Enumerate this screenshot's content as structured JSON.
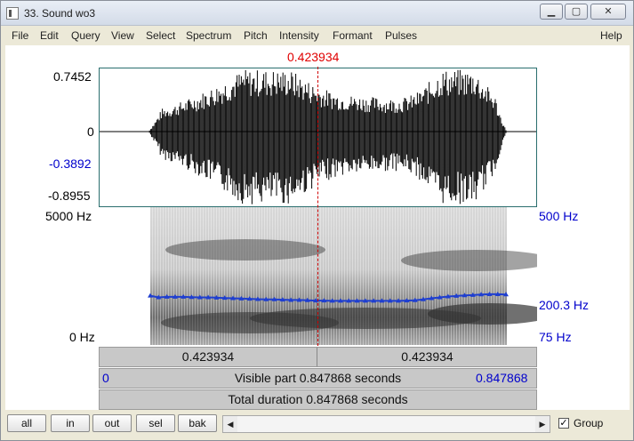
{
  "window": {
    "title": "33. Sound wo3",
    "controls": [
      "minimize-icon",
      "maximize-icon",
      "close-icon"
    ]
  },
  "menu": {
    "items": [
      "File",
      "Edit",
      "Query",
      "View",
      "Select",
      "Spectrum",
      "Pitch",
      "Intensity",
      "Formant",
      "Pulses"
    ],
    "help": "Help"
  },
  "cursor": {
    "time": "0.423934",
    "color": "#e00000"
  },
  "waveform": {
    "max": "0.7452",
    "zero": "0",
    "cursor_value": "-0.3892",
    "min": "-0.8955"
  },
  "spectrogram": {
    "freq_top": "5000 Hz",
    "freq_bottom": "0 Hz",
    "pitch_top": "500 Hz",
    "pitch_cursor": "200.3 Hz",
    "pitch_bottom": "75 Hz",
    "pitch_color": "#1f3fd0"
  },
  "pitch_track": [
    218,
    212,
    214,
    214,
    214,
    213,
    212,
    212,
    211,
    210,
    209,
    208,
    207,
    206,
    205,
    205,
    204,
    203,
    203,
    202,
    201,
    201,
    200,
    200,
    200,
    200,
    200,
    200,
    200,
    200,
    200,
    201,
    202,
    205,
    209,
    212,
    215,
    217,
    219,
    220,
    222,
    223,
    223,
    222
  ],
  "time_bars": {
    "left_segment": "0.423934",
    "right_segment": "0.423934",
    "visible_start": "0",
    "visible_label": "Visible part 0.847868 seconds",
    "visible_end": "0.847868",
    "total_label": "Total duration 0.847868 seconds"
  },
  "buttons": {
    "all": "all",
    "in": "in",
    "out": "out",
    "sel": "sel",
    "bak": "bak"
  },
  "group": {
    "label": "Group",
    "checked": true,
    "check_mark": "✓"
  },
  "scroll": {
    "left_arrow": "◀",
    "right_arrow": "▶"
  }
}
